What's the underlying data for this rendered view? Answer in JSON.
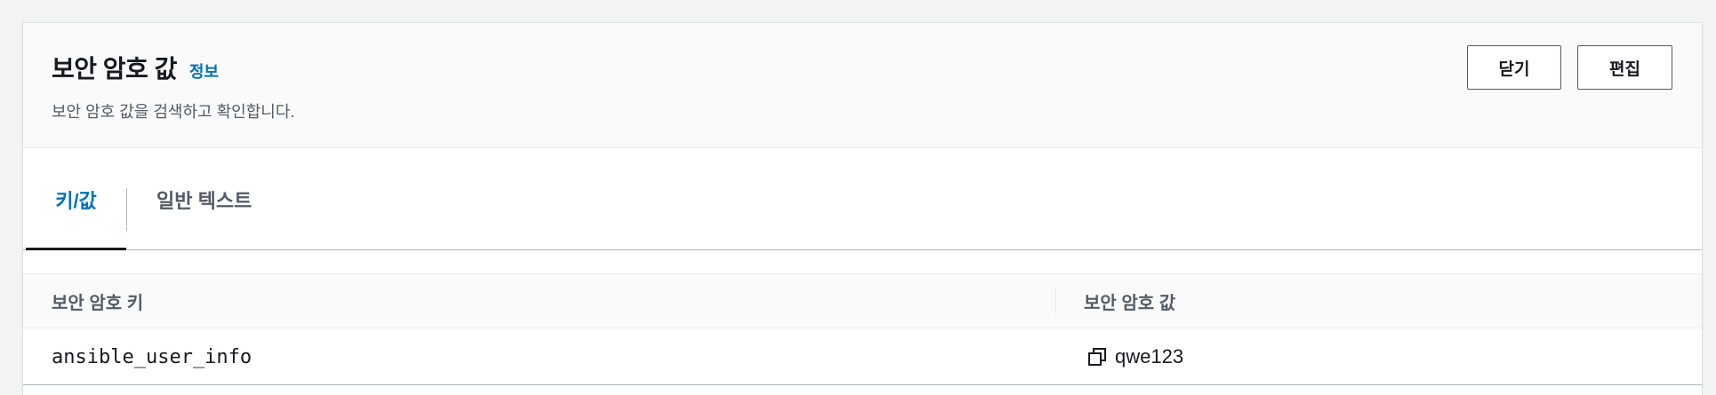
{
  "header": {
    "title": "보안 암호 값",
    "info_link": "정보",
    "description": "보안 암호 값을 검색하고 확인합니다.",
    "close_button": "닫기",
    "edit_button": "편집"
  },
  "tabs": [
    {
      "label": "키/값",
      "active": true
    },
    {
      "label": "일반 텍스트",
      "active": false
    }
  ],
  "table": {
    "columns": [
      "보안 암호 키",
      "보안 암호 값"
    ],
    "rows": [
      {
        "key": "ansible_user_info",
        "value": "qwe123"
      }
    ]
  },
  "icons": {
    "copy": "copy-icon"
  },
  "colors": {
    "accent": "#0073bb",
    "text": "#16191f",
    "muted": "#545b64"
  }
}
